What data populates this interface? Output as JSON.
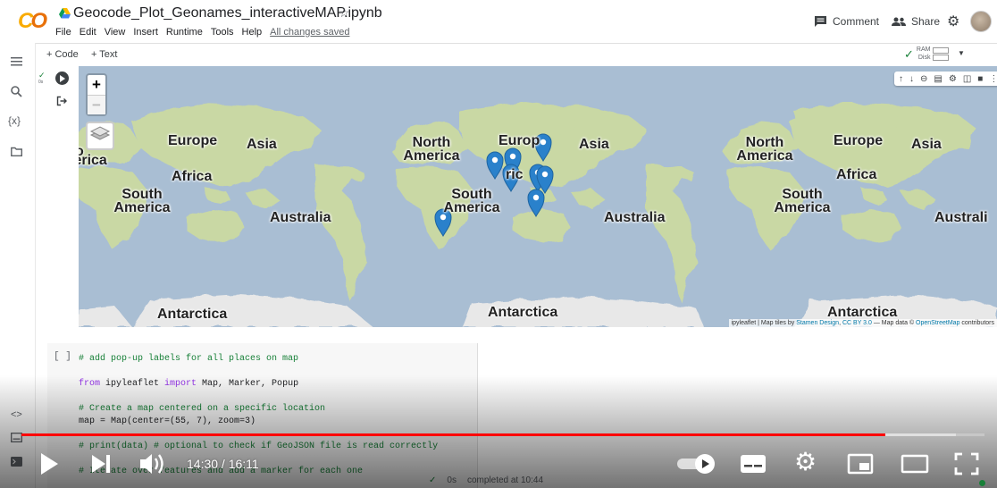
{
  "header": {
    "logo": "CO",
    "title": "Geocode_Plot_Geonames_interactiveMAP.ipynb",
    "menu": [
      "File",
      "Edit",
      "View",
      "Insert",
      "Runtime",
      "Tools",
      "Help"
    ],
    "save_status": "All changes saved",
    "comment_label": "Comment",
    "share_label": "Share"
  },
  "toolbar": {
    "add_code": "+ Code",
    "add_text": "+ Text",
    "ram_label": "RAM",
    "disk_label": "Disk"
  },
  "sidebar": {
    "icons": [
      "menu-icon",
      "search-icon",
      "variables-icon",
      "folder-icon",
      "code-snippets-icon",
      "command-palette-icon",
      "terminal-icon"
    ],
    "variables_label": "{x}"
  },
  "cell1": {
    "status_check": "✓",
    "exec_time": "0s",
    "map": {
      "zoom_in": "+",
      "zoom_out": "−",
      "labels": [
        {
          "text": "Europe"
        },
        {
          "text": "Asia"
        },
        {
          "text": "o"
        },
        {
          "text": "ierica"
        },
        {
          "text": "Africa"
        },
        {
          "text": "South America"
        },
        {
          "text": "Australia"
        },
        {
          "text": "North America"
        },
        {
          "text": "Europ"
        },
        {
          "text": "Asia"
        },
        {
          "text": "ric"
        },
        {
          "text": "South America"
        },
        {
          "text": "Australia"
        },
        {
          "text": "North America"
        },
        {
          "text": "Europe"
        },
        {
          "text": "Asia"
        },
        {
          "text": "Africa"
        },
        {
          "text": "South America"
        },
        {
          "text": "Australi"
        },
        {
          "text": "Antarctica"
        },
        {
          "text": "Antarctica"
        },
        {
          "text": "Antarctica"
        }
      ],
      "attribution_prefix": "ipyleaflet | Map tiles by ",
      "attribution_link1": "Stamen Design",
      "attribution_sep": ", ",
      "attribution_link2": "CC BY 3.0",
      "attribution_mid": " — Map data © ",
      "attribution_link3": "OpenStreetMap",
      "attribution_suffix": " contributors",
      "marker_color": "#2a81cb",
      "land_color": "#c9d8a4",
      "water_color": "#a9bed3"
    }
  },
  "cell2": {
    "bracket": "[ ]",
    "code_lines": [
      {
        "text": "# add pop-up labels for all places on map",
        "type": "comment"
      },
      {
        "text": "",
        "type": "blank"
      },
      {
        "kw": "from",
        "mid": " ipyleaflet ",
        "kw2": "import",
        "rest": " Map, Marker, Popup",
        "type": "import"
      },
      {
        "text": "",
        "type": "blank"
      },
      {
        "text": "# Create a map centered on a specific location",
        "type": "comment"
      },
      {
        "text": "map = Map(center=(55, 7), zoom=3)",
        "type": "code"
      },
      {
        "text": "",
        "type": "blank"
      },
      {
        "text": "# print(data) # optional to check if GeoJSON file is read correctly",
        "type": "comment"
      },
      {
        "text": "",
        "type": "blank"
      },
      {
        "text": "# Iterate over features and add a marker for each one",
        "type": "comment"
      }
    ]
  },
  "video": {
    "current_time": "14:30",
    "separator": " / ",
    "duration": "16:11",
    "progress": 0.897,
    "buffered": 0.97
  },
  "statusbar": {
    "check": "✓",
    "elapsed": "0s",
    "completed": "completed at 10:44"
  }
}
